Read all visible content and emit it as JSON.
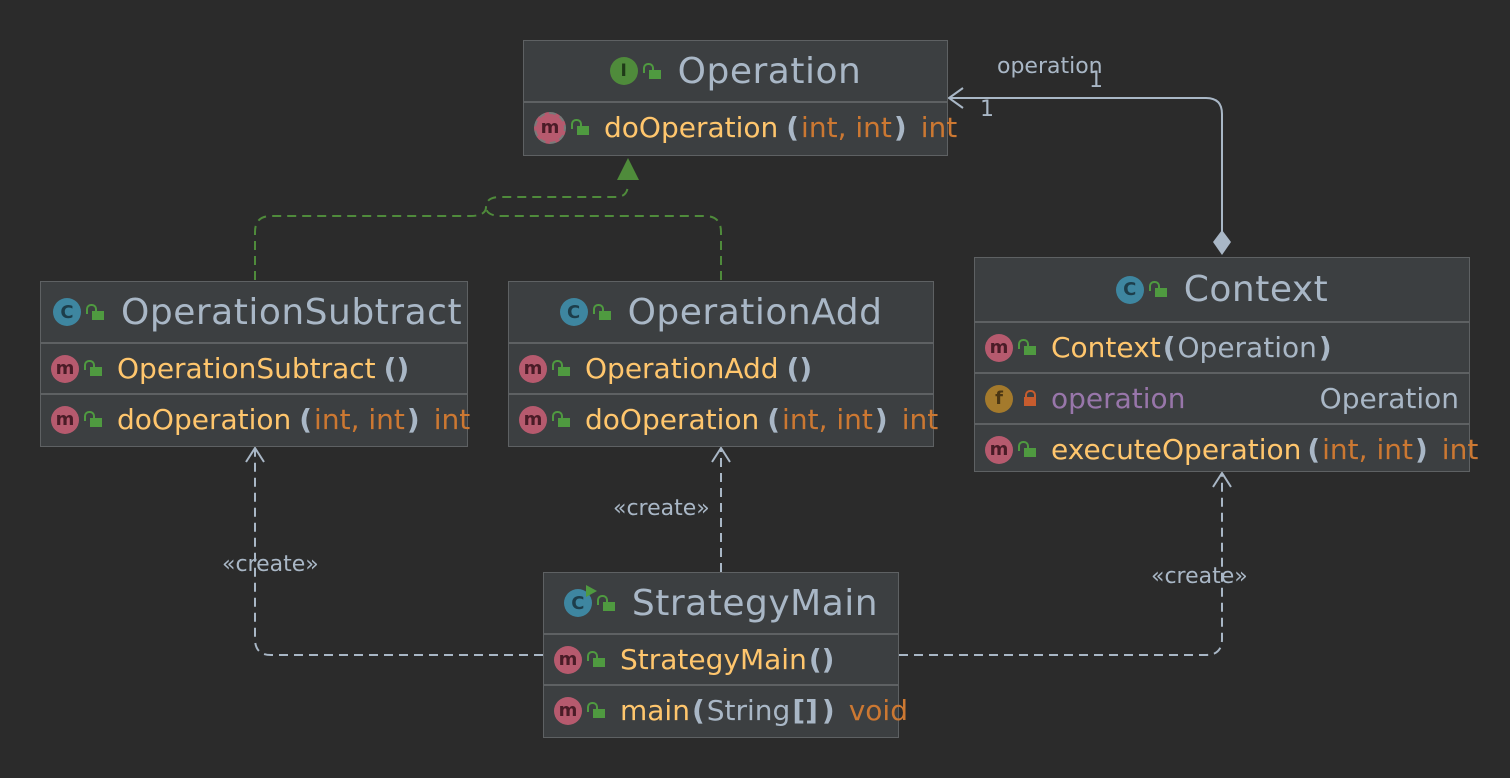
{
  "nodes": {
    "operation": {
      "title": "Operation",
      "kind": "interface",
      "badge": "I",
      "members": [
        {
          "badge": "m",
          "name": "doOperation",
          "open": "(",
          "params": [
            "int",
            ", ",
            "int"
          ],
          "close": ")",
          "returns": "int"
        }
      ]
    },
    "operation_subtract": {
      "title": "OperationSubtract",
      "kind": "class",
      "badge": "C",
      "members": [
        {
          "badge": "m",
          "name": "OperationSubtract",
          "paren": "()"
        },
        {
          "badge": "m",
          "name": "doOperation",
          "open": "(",
          "params": [
            "int",
            ", ",
            "int"
          ],
          "close": ")",
          "returns": "int"
        }
      ]
    },
    "operation_add": {
      "title": "OperationAdd",
      "kind": "class",
      "badge": "C",
      "members": [
        {
          "badge": "m",
          "name": "OperationAdd",
          "paren": "()"
        },
        {
          "badge": "m",
          "name": "doOperation",
          "open": "(",
          "params": [
            "int",
            ", ",
            "int"
          ],
          "close": ")",
          "returns": "int"
        }
      ]
    },
    "context": {
      "title": "Context",
      "kind": "class",
      "badge": "C",
      "members": [
        {
          "badge": "m",
          "name": "Context",
          "open": "(",
          "param_class": "Operation",
          "close": ")"
        },
        {
          "badge": "f",
          "name": "operation",
          "type": "Operation"
        },
        {
          "badge": "m",
          "name": "executeOperation",
          "open": "(",
          "params": [
            "int",
            ", ",
            "int"
          ],
          "close": ")",
          "returns": "int"
        }
      ]
    },
    "strategy_main": {
      "title": "StrategyMain",
      "kind": "class",
      "badge": "C",
      "members": [
        {
          "badge": "m",
          "name": "StrategyMain",
          "paren": "()"
        },
        {
          "badge": "m",
          "name": "main",
          "open": "(",
          "param_class": "String",
          "brackets": "[]",
          "close": ")",
          "returns": "void"
        }
      ]
    }
  },
  "edges": {
    "association_label": "operation",
    "multiplicity_source": "1",
    "multiplicity_target": "1",
    "create_label": "«create»"
  },
  "colors": {
    "background": "#2b2b2b",
    "node_bg": "#3c3f41",
    "border": "#5e6163",
    "realization": "#4f8b3b",
    "dependency": "#a9b7c6",
    "method_name": "#ffc66d",
    "primitive_type": "#cc7832",
    "field_name": "#9876aa"
  }
}
